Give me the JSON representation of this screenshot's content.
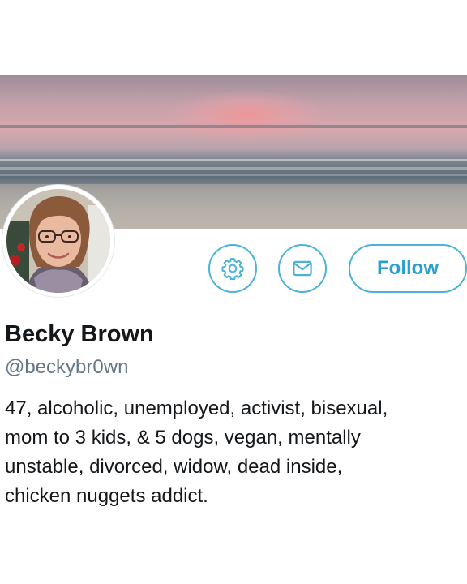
{
  "profile": {
    "display_name": "Becky Brown",
    "handle": "@beckybr0wn",
    "bio_lines": [
      "47, alcoholic, unemployed, activist, bisexual,",
      "mom to 3 kids, & 5 dogs, vegan, mentally",
      "unstable, divorced, widow, dead inside,",
      "chicken nuggets addict."
    ]
  },
  "actions": {
    "settings_icon": "gear-icon",
    "message_icon": "envelope-icon",
    "follow_label": "Follow"
  },
  "colors": {
    "accent": "#4bb3d8",
    "follow_text": "#2b9fd0",
    "name_text": "#14171a",
    "handle_text": "#657786"
  }
}
